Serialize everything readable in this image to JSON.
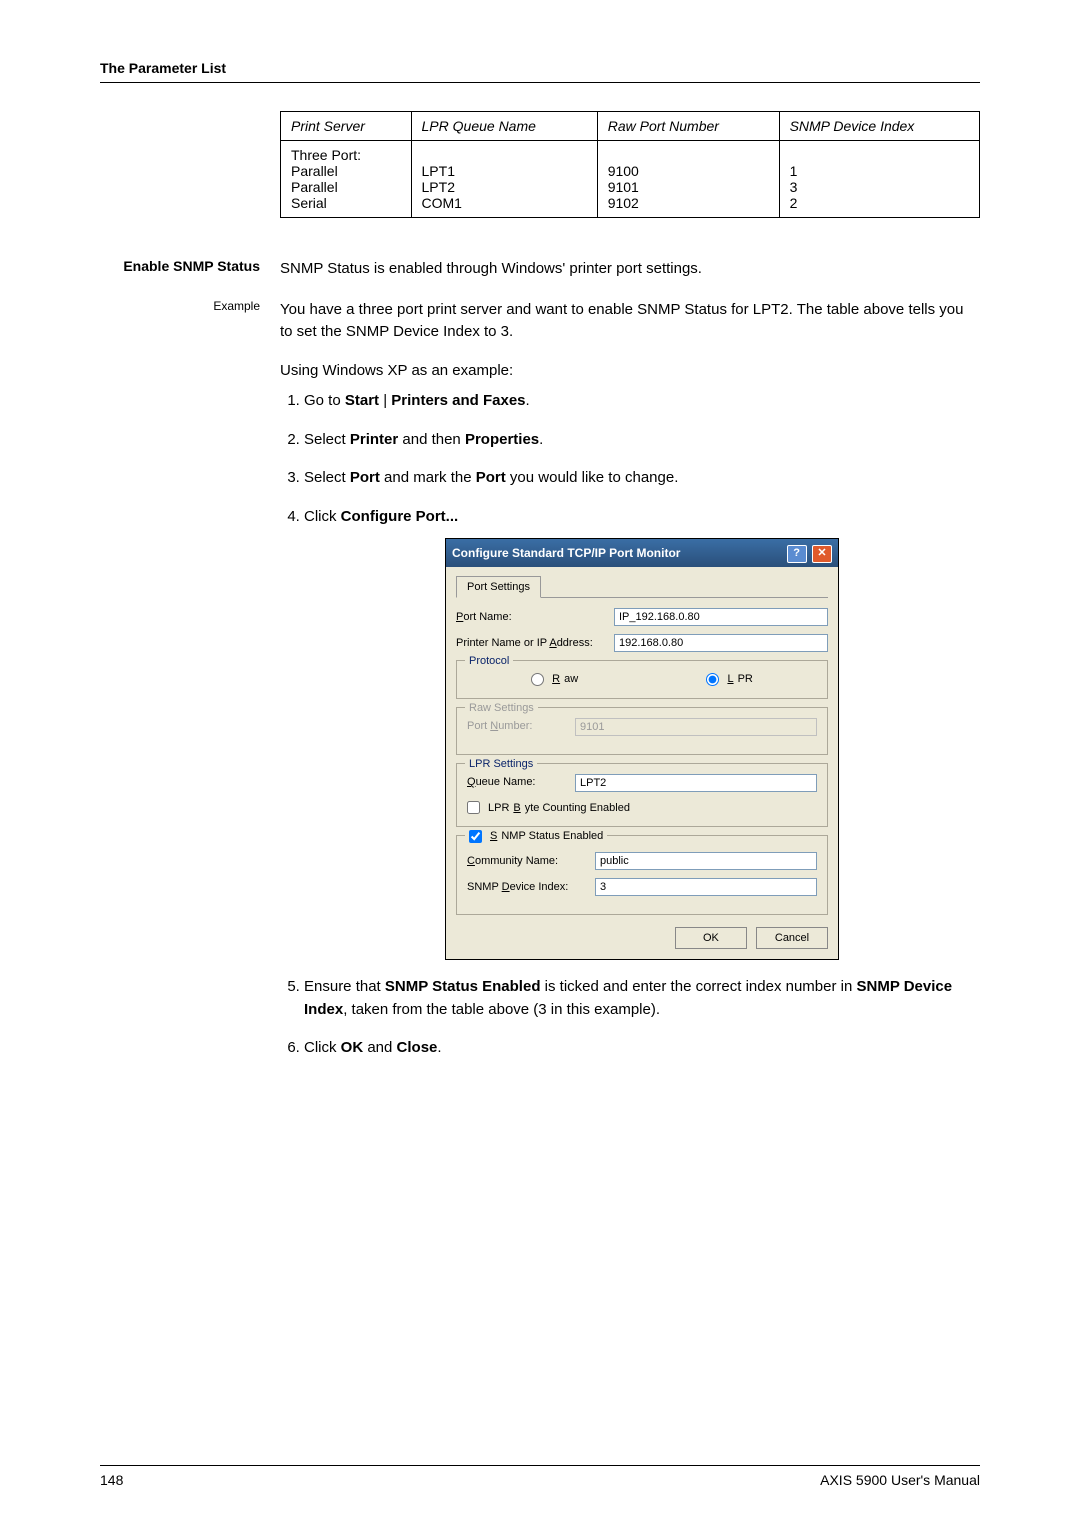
{
  "header": {
    "running_head": "The Parameter List"
  },
  "table": {
    "headers": [
      "Print Server",
      "LPR Queue Name",
      "Raw Port Number",
      "SNMP Device Index"
    ],
    "row1": [
      "Three Port:",
      "",
      "",
      ""
    ],
    "row2": [
      "Parallel",
      "LPT1",
      "9100",
      "1"
    ],
    "row3": [
      "Parallel",
      "LPT2",
      "9101",
      "3"
    ],
    "row4": [
      "Serial",
      "COM1",
      "9102",
      "2"
    ]
  },
  "sections": {
    "enable_label": "Enable SNMP Status",
    "enable_text": "SNMP Status is enabled through Windows' printer port settings.",
    "example_label": "Example",
    "example_p1": "You have a three port print server and want to enable SNMP Status for LPT2. The table above tells you to set the SNMP Device Index to 3.",
    "example_p2": "Using Windows XP as an example:",
    "steps": {
      "s1_pre": "Go to ",
      "s1_b1": "Start",
      "s1_sep": " | ",
      "s1_b2": "Printers and Faxes",
      "s1_post": ".",
      "s2_pre": "Select ",
      "s2_b1": "Printer",
      "s2_mid": " and then ",
      "s2_b2": "Properties",
      "s2_post": ".",
      "s3_pre": "Select ",
      "s3_b1": "Port",
      "s3_mid": " and mark the ",
      "s3_b2": "Port",
      "s3_post": " you would like to change.",
      "s4_pre": "Click ",
      "s4_b1": "Configure Port...",
      "s5_pre": "Ensure that ",
      "s5_b1": "SNMP Status Enabled",
      "s5_mid": " is ticked and enter the correct index number in ",
      "s5_b2": "SNMP Device Index",
      "s5_post": ", taken from the table above (3 in this example).",
      "s6_pre": "Click ",
      "s6_b1": "OK",
      "s6_mid": " and ",
      "s6_b2": "Close",
      "s6_post": "."
    }
  },
  "dialog": {
    "title": "Configure Standard TCP/IP Port Monitor",
    "help_icon": "?",
    "close_icon": "✕",
    "tab": "Port Settings",
    "port_name_label_pre": "P",
    "port_name_label_rest": "ort Name:",
    "port_name_value": "IP_192.168.0.80",
    "printer_addr_label_pre": "Printer Name or IP ",
    "printer_addr_label_u": "A",
    "printer_addr_label_post": "ddress:",
    "printer_addr_value": "192.168.0.80",
    "protocol_legend": "Protocol",
    "raw_u": "R",
    "raw_rest": "aw",
    "lpr_u": "L",
    "lpr_rest": "PR",
    "raw_legend": "Raw Settings",
    "raw_port_label_pre": "Port ",
    "raw_port_label_u": "N",
    "raw_port_label_post": "umber:",
    "raw_port_value": "9101",
    "lpr_legend": "LPR Settings",
    "queue_label_u": "Q",
    "queue_label_rest": "ueue Name:",
    "queue_value": "LPT2",
    "lpr_byte_pre": "LPR ",
    "lpr_byte_u": "B",
    "lpr_byte_post": "yte Counting Enabled",
    "snmp_enabled_u": "S",
    "snmp_enabled_rest": "NMP Status Enabled",
    "community_label_u": "C",
    "community_label_rest": "ommunity Name:",
    "community_value": "public",
    "device_index_label_pre": "SNMP ",
    "device_index_label_u": "D",
    "device_index_label_post": "evice Index:",
    "device_index_value": "3",
    "ok": "OK",
    "cancel": "Cancel"
  },
  "footer": {
    "page_number": "148",
    "doc_title": "AXIS 5900 User's Manual"
  }
}
